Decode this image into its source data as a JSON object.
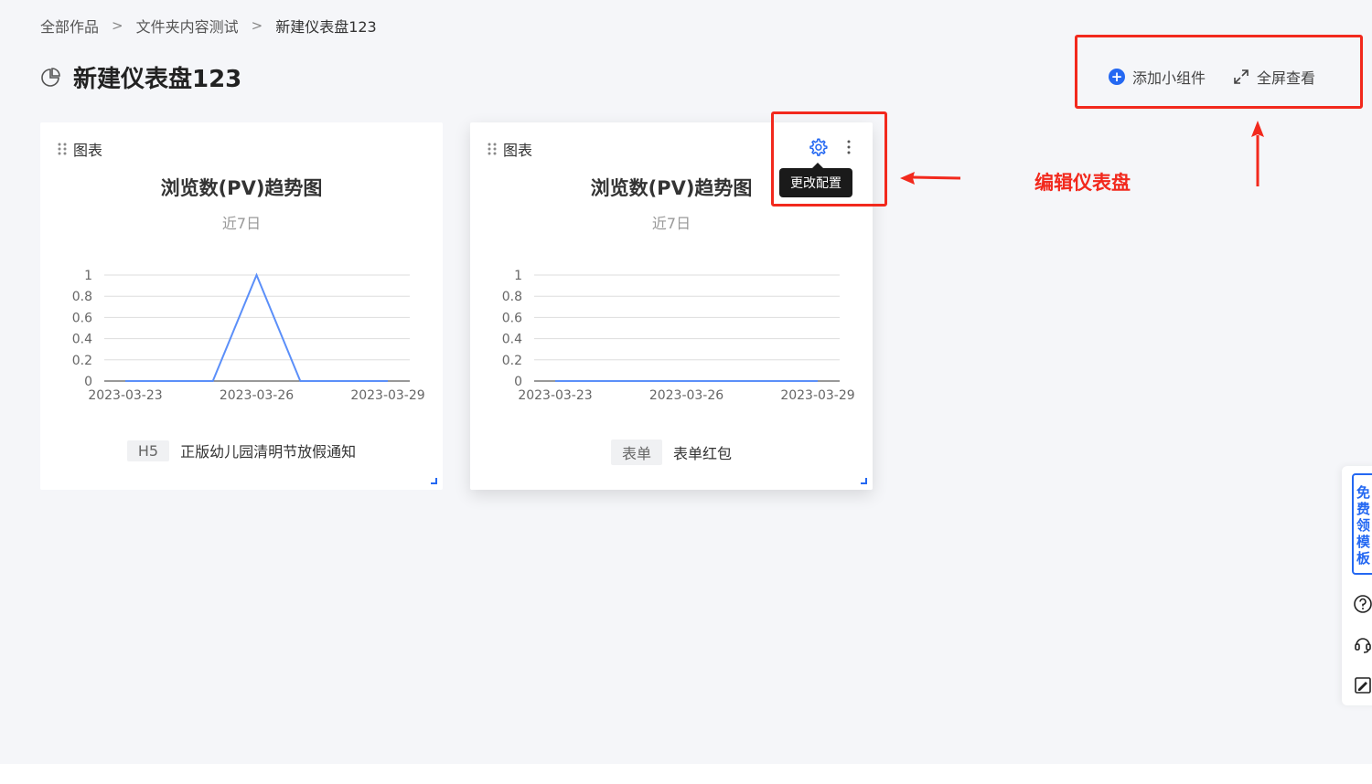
{
  "breadcrumb": {
    "items": [
      "全部作品",
      "文件夹内容测试",
      "新建仪表盘123"
    ],
    "separator": ">"
  },
  "page": {
    "title": "新建仪表盘123",
    "title_icon": "pie-chart-icon"
  },
  "actions": {
    "add_widget": "添加小组件",
    "fullscreen": "全屏查看"
  },
  "colors": {
    "accent": "#2468f2",
    "line": "#5b8ff9",
    "annotation": "#f2291d"
  },
  "cards": [
    {
      "header": "图表",
      "title": "浏览数(PV)趋势图",
      "subtitle": "近7日",
      "tag": "H5",
      "source_name": "正版幼儿园清明节放假通知"
    },
    {
      "header": "图表",
      "title": "浏览数(PV)趋势图",
      "subtitle": "近7日",
      "tag": "表单",
      "source_name": "表单红包",
      "tooltip": "更改配置"
    }
  ],
  "chart_data": [
    {
      "type": "line",
      "x": [
        "2023-03-23",
        "2023-03-24",
        "2023-03-25",
        "2023-03-26",
        "2023-03-27",
        "2023-03-28",
        "2023-03-29"
      ],
      "x_tick_labels": [
        "2023-03-23",
        "2023-03-26",
        "2023-03-29"
      ],
      "y_tick_labels": [
        "0",
        "0.2",
        "0.4",
        "0.6",
        "0.8",
        "1"
      ],
      "series": [
        {
          "values": [
            0,
            0,
            0,
            1,
            0,
            0,
            0
          ]
        }
      ],
      "ylim": [
        0,
        1
      ],
      "grid": true
    },
    {
      "type": "line",
      "x": [
        "2023-03-23",
        "2023-03-24",
        "2023-03-25",
        "2023-03-26",
        "2023-03-27",
        "2023-03-28",
        "2023-03-29"
      ],
      "x_tick_labels": [
        "2023-03-23",
        "2023-03-26",
        "2023-03-29"
      ],
      "y_tick_labels": [
        "0",
        "0.2",
        "0.4",
        "0.6",
        "0.8",
        "1"
      ],
      "series": [
        {
          "values": [
            0,
            0,
            0,
            0,
            0,
            0,
            0
          ]
        }
      ],
      "ylim": [
        0,
        1
      ],
      "grid": true
    }
  ],
  "annotation": {
    "label": "编辑仪表盘"
  },
  "side_panel": {
    "template_button": [
      "免",
      "费",
      "领",
      "模",
      "板"
    ],
    "icons": [
      "help-icon",
      "customer-service-icon",
      "feedback-icon"
    ]
  }
}
